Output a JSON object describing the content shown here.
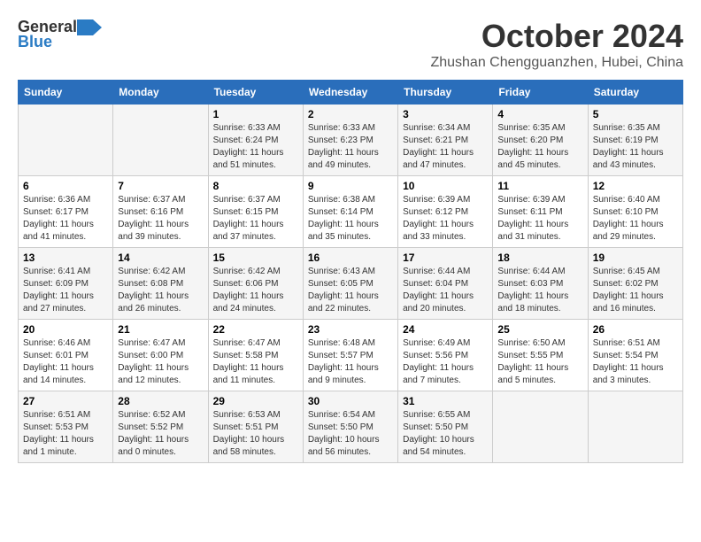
{
  "logo": {
    "general": "General",
    "blue": "Blue"
  },
  "title": "October 2024",
  "location": "Zhushan Chengguanzhen, Hubei, China",
  "weekdays": [
    "Sunday",
    "Monday",
    "Tuesday",
    "Wednesday",
    "Thursday",
    "Friday",
    "Saturday"
  ],
  "weeks": [
    [
      {
        "day": "",
        "detail": ""
      },
      {
        "day": "",
        "detail": ""
      },
      {
        "day": "1",
        "detail": "Sunrise: 6:33 AM\nSunset: 6:24 PM\nDaylight: 11 hours and 51 minutes."
      },
      {
        "day": "2",
        "detail": "Sunrise: 6:33 AM\nSunset: 6:23 PM\nDaylight: 11 hours and 49 minutes."
      },
      {
        "day": "3",
        "detail": "Sunrise: 6:34 AM\nSunset: 6:21 PM\nDaylight: 11 hours and 47 minutes."
      },
      {
        "day": "4",
        "detail": "Sunrise: 6:35 AM\nSunset: 6:20 PM\nDaylight: 11 hours and 45 minutes."
      },
      {
        "day": "5",
        "detail": "Sunrise: 6:35 AM\nSunset: 6:19 PM\nDaylight: 11 hours and 43 minutes."
      }
    ],
    [
      {
        "day": "6",
        "detail": "Sunrise: 6:36 AM\nSunset: 6:17 PM\nDaylight: 11 hours and 41 minutes."
      },
      {
        "day": "7",
        "detail": "Sunrise: 6:37 AM\nSunset: 6:16 PM\nDaylight: 11 hours and 39 minutes."
      },
      {
        "day": "8",
        "detail": "Sunrise: 6:37 AM\nSunset: 6:15 PM\nDaylight: 11 hours and 37 minutes."
      },
      {
        "day": "9",
        "detail": "Sunrise: 6:38 AM\nSunset: 6:14 PM\nDaylight: 11 hours and 35 minutes."
      },
      {
        "day": "10",
        "detail": "Sunrise: 6:39 AM\nSunset: 6:12 PM\nDaylight: 11 hours and 33 minutes."
      },
      {
        "day": "11",
        "detail": "Sunrise: 6:39 AM\nSunset: 6:11 PM\nDaylight: 11 hours and 31 minutes."
      },
      {
        "day": "12",
        "detail": "Sunrise: 6:40 AM\nSunset: 6:10 PM\nDaylight: 11 hours and 29 minutes."
      }
    ],
    [
      {
        "day": "13",
        "detail": "Sunrise: 6:41 AM\nSunset: 6:09 PM\nDaylight: 11 hours and 27 minutes."
      },
      {
        "day": "14",
        "detail": "Sunrise: 6:42 AM\nSunset: 6:08 PM\nDaylight: 11 hours and 26 minutes."
      },
      {
        "day": "15",
        "detail": "Sunrise: 6:42 AM\nSunset: 6:06 PM\nDaylight: 11 hours and 24 minutes."
      },
      {
        "day": "16",
        "detail": "Sunrise: 6:43 AM\nSunset: 6:05 PM\nDaylight: 11 hours and 22 minutes."
      },
      {
        "day": "17",
        "detail": "Sunrise: 6:44 AM\nSunset: 6:04 PM\nDaylight: 11 hours and 20 minutes."
      },
      {
        "day": "18",
        "detail": "Sunrise: 6:44 AM\nSunset: 6:03 PM\nDaylight: 11 hours and 18 minutes."
      },
      {
        "day": "19",
        "detail": "Sunrise: 6:45 AM\nSunset: 6:02 PM\nDaylight: 11 hours and 16 minutes."
      }
    ],
    [
      {
        "day": "20",
        "detail": "Sunrise: 6:46 AM\nSunset: 6:01 PM\nDaylight: 11 hours and 14 minutes."
      },
      {
        "day": "21",
        "detail": "Sunrise: 6:47 AM\nSunset: 6:00 PM\nDaylight: 11 hours and 12 minutes."
      },
      {
        "day": "22",
        "detail": "Sunrise: 6:47 AM\nSunset: 5:58 PM\nDaylight: 11 hours and 11 minutes."
      },
      {
        "day": "23",
        "detail": "Sunrise: 6:48 AM\nSunset: 5:57 PM\nDaylight: 11 hours and 9 minutes."
      },
      {
        "day": "24",
        "detail": "Sunrise: 6:49 AM\nSunset: 5:56 PM\nDaylight: 11 hours and 7 minutes."
      },
      {
        "day": "25",
        "detail": "Sunrise: 6:50 AM\nSunset: 5:55 PM\nDaylight: 11 hours and 5 minutes."
      },
      {
        "day": "26",
        "detail": "Sunrise: 6:51 AM\nSunset: 5:54 PM\nDaylight: 11 hours and 3 minutes."
      }
    ],
    [
      {
        "day": "27",
        "detail": "Sunrise: 6:51 AM\nSunset: 5:53 PM\nDaylight: 11 hours and 1 minute."
      },
      {
        "day": "28",
        "detail": "Sunrise: 6:52 AM\nSunset: 5:52 PM\nDaylight: 11 hours and 0 minutes."
      },
      {
        "day": "29",
        "detail": "Sunrise: 6:53 AM\nSunset: 5:51 PM\nDaylight: 10 hours and 58 minutes."
      },
      {
        "day": "30",
        "detail": "Sunrise: 6:54 AM\nSunset: 5:50 PM\nDaylight: 10 hours and 56 minutes."
      },
      {
        "day": "31",
        "detail": "Sunrise: 6:55 AM\nSunset: 5:50 PM\nDaylight: 10 hours and 54 minutes."
      },
      {
        "day": "",
        "detail": ""
      },
      {
        "day": "",
        "detail": ""
      }
    ]
  ]
}
